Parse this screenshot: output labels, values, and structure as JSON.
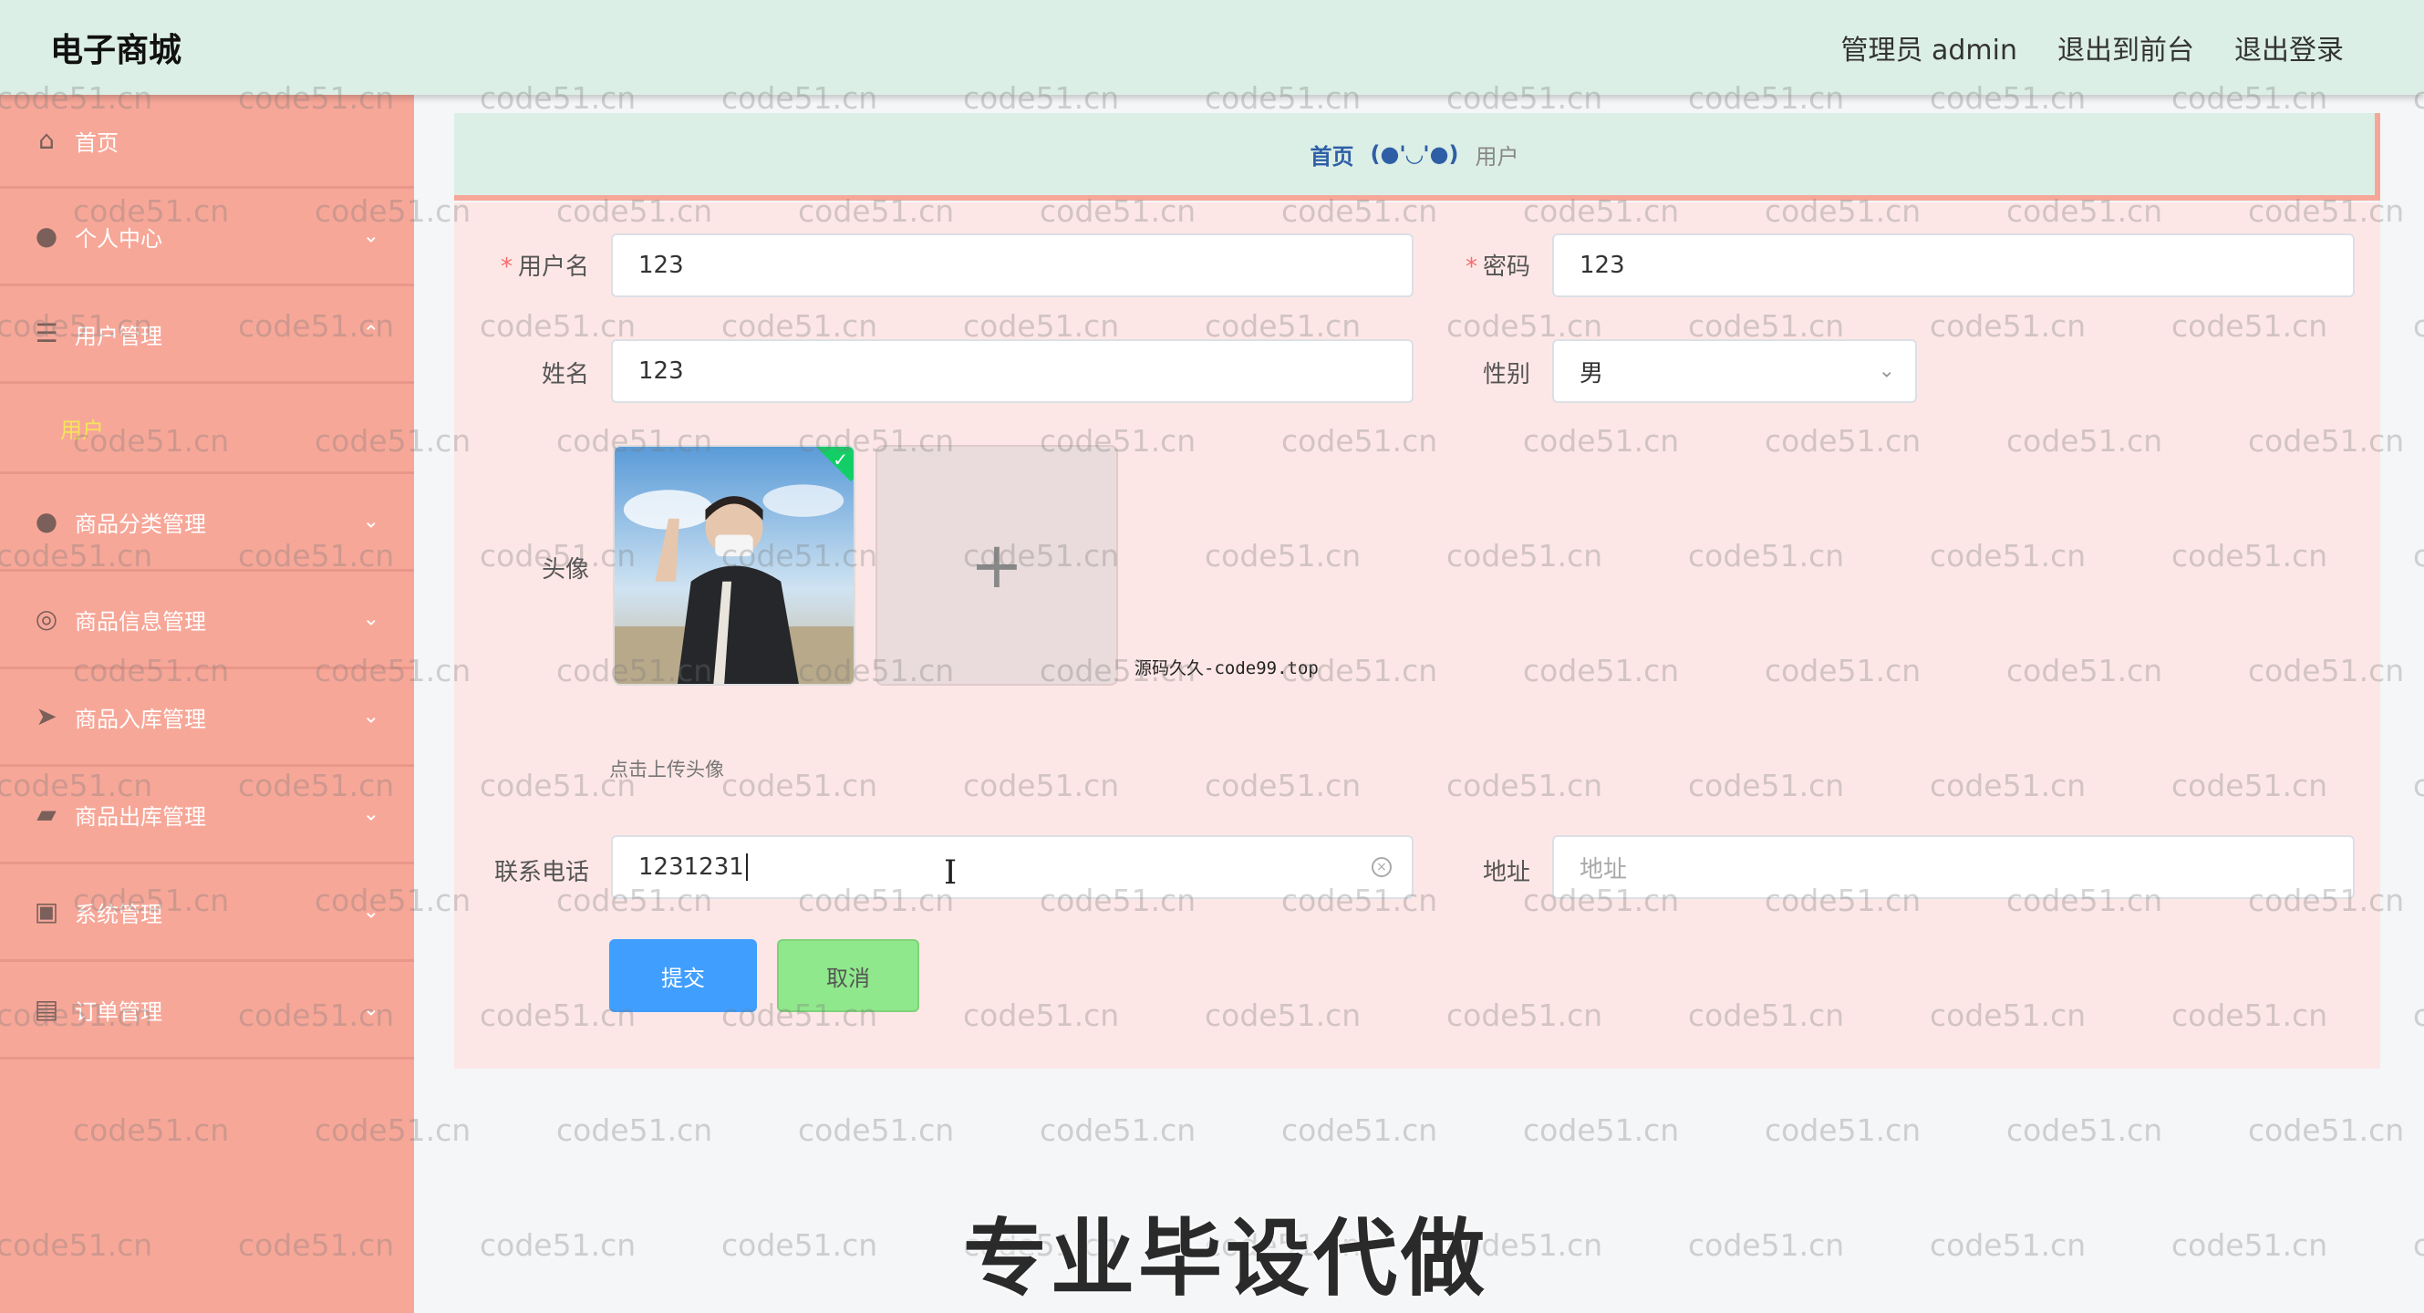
{
  "header": {
    "brand": "电子商城",
    "admin_label": "管理员 admin",
    "front_link": "退出到前台",
    "logout_link": "退出登录"
  },
  "sidebar": {
    "items": [
      {
        "label": "首页",
        "icon": "home-icon"
      },
      {
        "label": "个人中心",
        "icon": "person-icon"
      },
      {
        "label": "用户管理",
        "icon": "menu-icon"
      },
      {
        "label": "商品分类管理",
        "icon": "person-icon"
      },
      {
        "label": "商品信息管理",
        "icon": "circle-icon"
      },
      {
        "label": "商品入库管理",
        "icon": "send-icon"
      },
      {
        "label": "商品出库管理",
        "icon": "wallet-icon"
      },
      {
        "label": "系统管理",
        "icon": "box-icon"
      },
      {
        "label": "订单管理",
        "icon": "briefcase-icon"
      }
    ],
    "submenu_user": "用户"
  },
  "breadcrumb": {
    "home": "首页",
    "separator": "(●'◡'●)",
    "current": "用户"
  },
  "form": {
    "username_label": "用户名",
    "username_value": "123",
    "password_label": "密码",
    "password_value": "123",
    "name_label": "姓名",
    "name_value": "123",
    "gender_label": "性别",
    "gender_value": "男",
    "avatar_label": "头像",
    "upload_plus": "+",
    "upload_tip": "点击上传头像",
    "note": "源码久久-code99.top",
    "phone_label": "联系电话",
    "phone_value": "1231231",
    "address_label": "地址",
    "address_placeholder": "地址",
    "required_mark": "*",
    "submit_label": "提交",
    "cancel_label": "取消"
  },
  "watermark_text": "code51.cn",
  "caption": "专业毕设代做",
  "colors": {
    "header_bg": "#dcefe6",
    "sidebar_bg": "#f7a798",
    "panel_bg": "#fde7e6",
    "submit": "#409eff",
    "cancel": "#90e88c",
    "submenu_active": "#f5e45a"
  }
}
